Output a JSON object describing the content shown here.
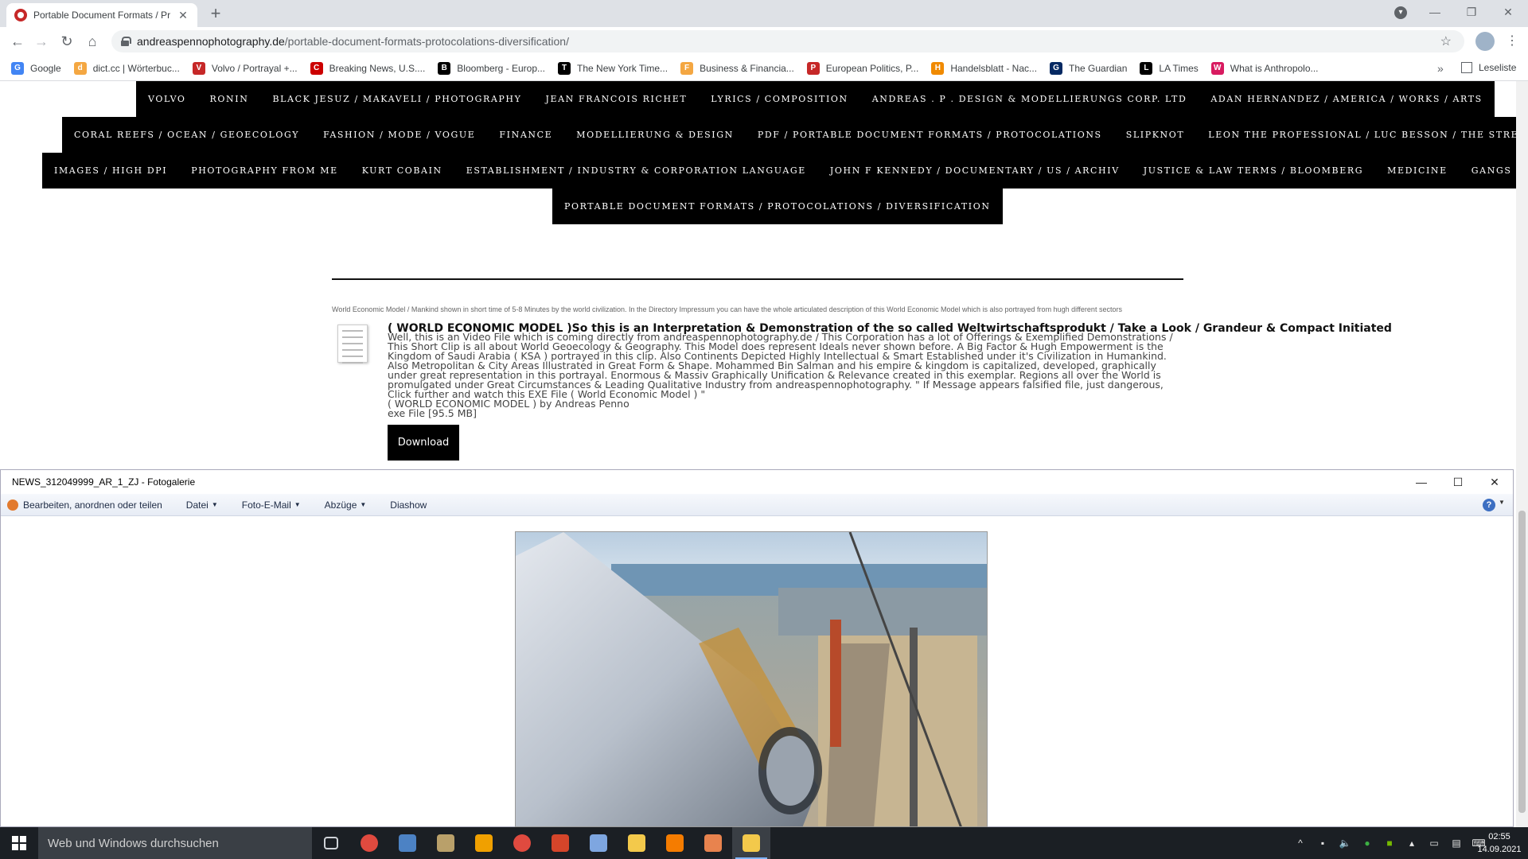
{
  "browser": {
    "tab_title": "Portable Document Formats / Pr",
    "url_host": "andreaspennophotography.de",
    "url_path": "/portable-document-formats-protocolations-diversification/",
    "bookmarks": [
      {
        "label": "Google",
        "color": "#4285f4",
        "glyph": "G"
      },
      {
        "label": "dict.cc | Wörterbuc...",
        "color": "#f4a742",
        "glyph": "d"
      },
      {
        "label": "Volvo / Portrayal +...",
        "color": "#c62828",
        "glyph": "V"
      },
      {
        "label": "Breaking News, U.S....",
        "color": "#cc0000",
        "glyph": "C"
      },
      {
        "label": "Bloomberg - Europ...",
        "color": "#000000",
        "glyph": "B"
      },
      {
        "label": "The New York Time...",
        "color": "#000000",
        "glyph": "T"
      },
      {
        "label": "Business & Financia...",
        "color": "#f4a742",
        "glyph": "F"
      },
      {
        "label": "European Politics, P...",
        "color": "#c62828",
        "glyph": "P"
      },
      {
        "label": "Handelsblatt - Nac...",
        "color": "#f08a00",
        "glyph": "H"
      },
      {
        "label": "The Guardian",
        "color": "#052962",
        "glyph": "G"
      },
      {
        "label": "LA Times",
        "color": "#000000",
        "glyph": "L"
      },
      {
        "label": "What is Anthropolo...",
        "color": "#d81b60",
        "glyph": "W"
      }
    ],
    "bookmarks_more": "»",
    "reading_list": "Leseliste"
  },
  "site_nav": {
    "row1": [
      "VOLVO",
      "RONIN",
      "BLACK JESUZ / MAKAVELI / PHOTOGRAPHY",
      "JEAN FRANCOIS RICHET",
      "LYRICS / COMPOSITION",
      "ANDREAS . P . DESIGN & MODELLIERUNGS CORP. LTD",
      "ADAN HERNANDEZ / AMERICA / WORKS / ARTS"
    ],
    "row2": [
      "CORAL REEFS / OCEAN / GEOECOLOGY",
      "FASHION / MODE / VOGUE",
      "FINANCE",
      "MODELLIERUNG & DESIGN",
      "PDF / PORTABLE DOCUMENT FORMATS / PROTOCOLATIONS",
      "SLIPKNOT",
      "LEON THE PROFESSIONAL / LUC BESSON / THE STREETS / ART"
    ],
    "row3": [
      "IMAGES / HIGH DPI",
      "PHOTOGRAPHY FROM ME",
      "KURT COBAIN",
      "ESTABLISHMENT / INDUSTRY & CORPORATION LANGUAGE",
      "JOHN F KENNEDY / DOCUMENTARY / US / ARCHIV",
      "JUSTICE & LAW TERMS / BLOOMBERG",
      "MEDICINE",
      "GANGS OF NEW YORK"
    ],
    "row4": [
      "PORTABLE DOCUMENT FORMATS / PROTOCOLATIONS / DIVERSIFICATION"
    ]
  },
  "content": {
    "download_label": "Download",
    "caption": "World Economic Model / Mankind shown in short time of 5-8 Minutes by the world civilization. In the Directory Impressum  you can have the whole articulated description of this World Economic Model which is also portrayed from hugh different  sectors",
    "file_title": "( WORLD ECONOMIC MODEL )So this is an Interpretation & Demonstration of the so called Weltwirtschaftsprodukt / Take a Look / Grandeur & Compact Initiated",
    "file_description": "Well, this is an Video File which is coming directly from andreaspennophotography.de / This Corporation has a lot of Offerings & Exemplified Demonstrations / This Short Clip is all about World Geoecology & Geography. This Model does represent Ideals never shown before. A Big Factor & Hugh Empowerment is the Kingdom of Saudi Arabia ( KSA ) portrayed in this clip. Also Continents Depicted Highly Intellectual & Smart Established under it's Civilization in Humankind. Also Metropolitan & City Areas Illustrated in Great Form & Shape. Mohammed Bin Salman and his empire & kingdom is capitalized, developed, graphically under great representation in this portrayal. Enormous & Massiv Graphically Unification & Relevance created in this exemplar. Regions all over the World is promulgated under Great Circumstances & Leading Qualitative Industry from andreaspennophotography. \" If Message appears falsified file, just dangerous, Click further and watch this EXE File ( World Economic Model ) \"",
    "file_by": "( WORLD ECONOMIC MODEL ) by Andreas Penno",
    "file_size": "exe File [95.5 MB]"
  },
  "gallery": {
    "title": "NEWS_312049999_AR_1_ZJ - Fotogalerie",
    "menu": [
      "Bearbeiten, anordnen oder teilen",
      "Datei",
      "Foto-E-Mail",
      "Abzüge",
      "Diashow"
    ],
    "help": "?"
  },
  "taskbar": {
    "search_placeholder": "Web und Windows durchsuchen",
    "apps": [
      {
        "name": "task-view",
        "color": "#cfd3d8"
      },
      {
        "name": "chrome",
        "color": "#e04a3f"
      },
      {
        "name": "word-doc",
        "color": "#4c82c4"
      },
      {
        "name": "photo-viewer",
        "color": "#b9a06a"
      },
      {
        "name": "vlc-like",
        "color": "#f0a000"
      },
      {
        "name": "chrome-2",
        "color": "#e04a3f"
      },
      {
        "name": "app-red",
        "color": "#d4452a"
      },
      {
        "name": "picasa",
        "color": "#7ea6e0"
      },
      {
        "name": "file-explorer",
        "color": "#f3c94b"
      },
      {
        "name": "vlc",
        "color": "#f57c00"
      },
      {
        "name": "app-toolbox",
        "color": "#e8834e"
      },
      {
        "name": "photo-gallery",
        "color": "#f3c94b"
      }
    ],
    "time": "02:55",
    "date": "14.09.2021"
  }
}
